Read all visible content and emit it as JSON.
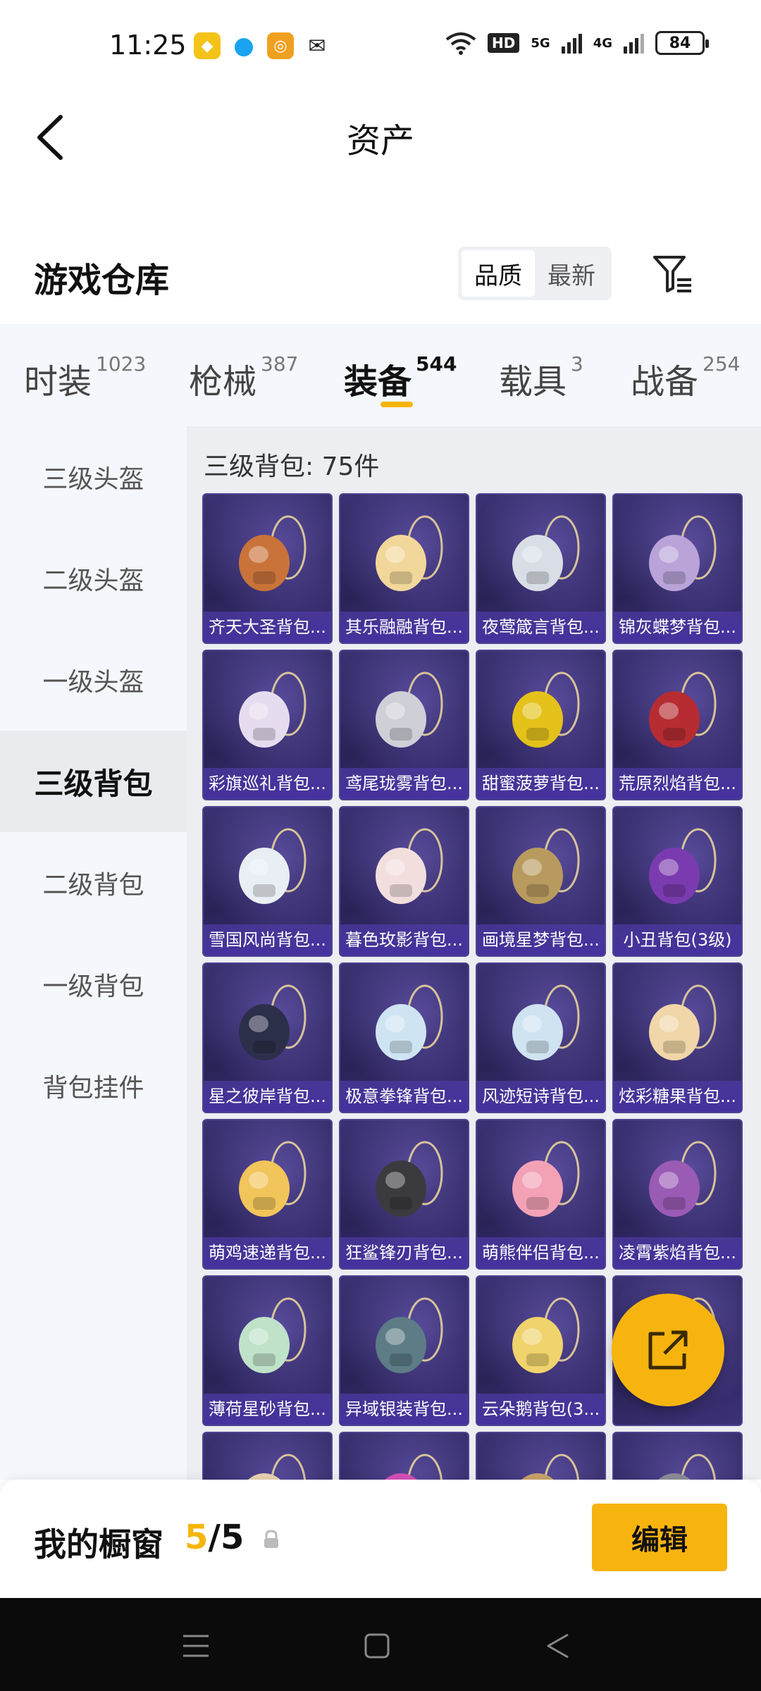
{
  "status_bar": {
    "time": "11:25",
    "hd_label": "HD",
    "net1": "5G",
    "net2": "4G",
    "battery": "84"
  },
  "header": {
    "title": "资产"
  },
  "warehouse": {
    "title": "游戏仓库",
    "sort_options": [
      "品质",
      "最新"
    ],
    "active_sort": "品质"
  },
  "tabs": [
    {
      "label": "时装",
      "count": "1023"
    },
    {
      "label": "枪械",
      "count": "387"
    },
    {
      "label": "装备",
      "count": "544"
    },
    {
      "label": "载具",
      "count": "3"
    },
    {
      "label": "战备",
      "count": "254"
    }
  ],
  "active_tab": "装备",
  "sidebar": {
    "items": [
      "三级头盔",
      "二级头盔",
      "一级头盔",
      "三级背包",
      "二级背包",
      "一级背包",
      "背包挂件"
    ],
    "active": "三级背包"
  },
  "section": {
    "title": "三级背包: 75件"
  },
  "items": [
    "齐天大圣背包...",
    "其乐融融背包...",
    "夜莺箴言背包...",
    "锦灰蝶梦背包...",
    "彩旗巡礼背包...",
    "鸢尾珑雾背包...",
    "甜蜜菠萝背包...",
    "荒原烈焰背包...",
    "雪国风尚背包...",
    "暮色玫影背包...",
    "画境星梦背包...",
    "小丑背包(3级)",
    "星之彼岸背包...",
    "极意拳锋背包...",
    "风迹短诗背包...",
    "炫彩糖果背包...",
    "萌鸡速递背包...",
    "狂鲨锋刃背包...",
    "萌熊伴侣背包...",
    "凌霄紫焰背包...",
    "薄荷星砂背包...",
    "异域银装背包...",
    "云朵鹅背包(3...",
    "",
    "",
    "",
    "",
    ""
  ],
  "colors": {
    "accent": "#f5b50a",
    "card_bg": "#2a2358"
  },
  "bottom_bar": {
    "showcase_label": "我的橱窗",
    "count_current": "5",
    "count_total": "/5",
    "edit_label": "编辑"
  }
}
